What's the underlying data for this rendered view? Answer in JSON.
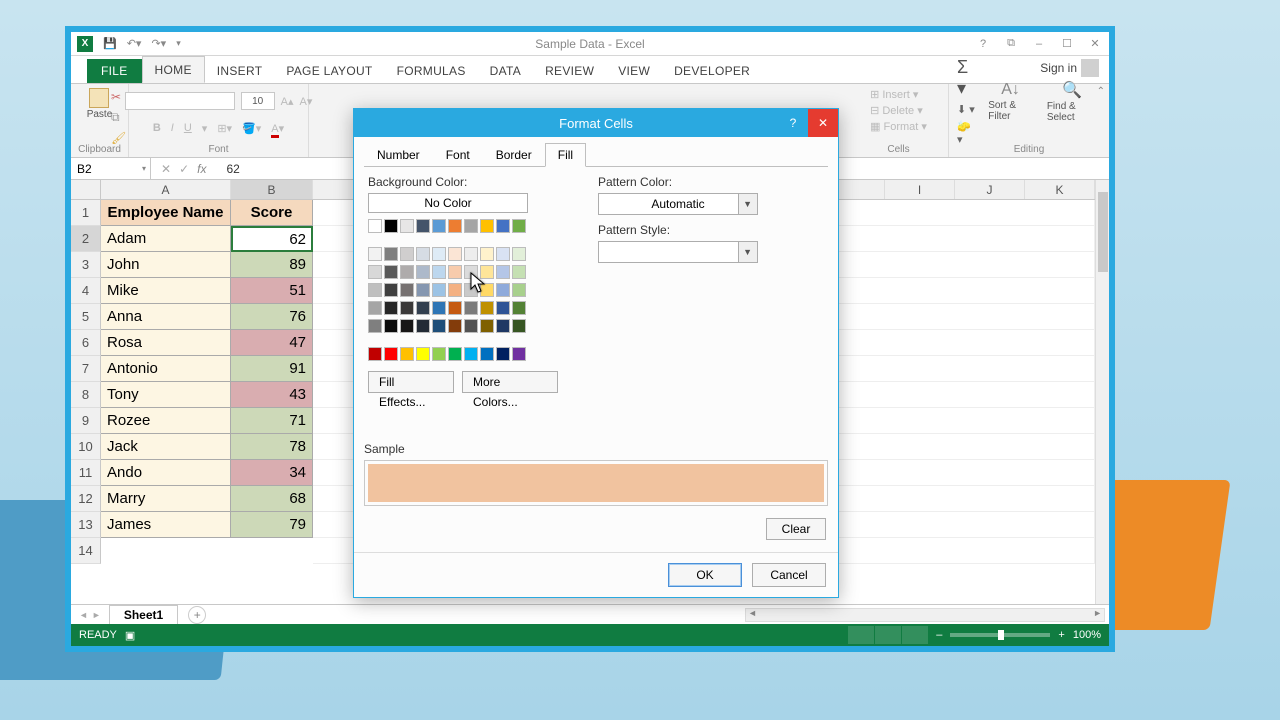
{
  "titlebar": {
    "title": "Sample Data - Excel"
  },
  "winbtns": {
    "help": "?",
    "rest": "⧉",
    "min": "–",
    "max": "☐",
    "close": "✕"
  },
  "ribbon_tabs": {
    "file": "FILE",
    "home": "HOME",
    "insert": "INSERT",
    "page_layout": "PAGE LAYOUT",
    "formulas": "FORMULAS",
    "data": "DATA",
    "review": "REVIEW",
    "view": "VIEW",
    "developer": "DEVELOPER",
    "signin": "Sign in"
  },
  "ribbon": {
    "paste": "Paste",
    "clipboard": "Clipboard",
    "font": "Font",
    "font_size": "10",
    "insert": "Insert",
    "delete": "Delete",
    "format": "Format",
    "cells": "Cells",
    "sort": "Sort & Filter",
    "find": "Find & Select",
    "editing": "Editing"
  },
  "formula_bar": {
    "name": "B2",
    "cancel": "✕",
    "enter": "✓",
    "fx": "fx",
    "value": "62"
  },
  "columns": {
    "a": "A",
    "b": "B",
    "i": "I",
    "j": "J",
    "k": "K"
  },
  "headers": {
    "name": "Employee Name",
    "score": "Score"
  },
  "rows": [
    {
      "n": 2,
      "name": "Adam",
      "score": 62,
      "cls": "sel"
    },
    {
      "n": 3,
      "name": "John",
      "score": 89,
      "cls": "score-green"
    },
    {
      "n": 4,
      "name": "Mike",
      "score": 51,
      "cls": "score-red"
    },
    {
      "n": 5,
      "name": "Anna",
      "score": 76,
      "cls": "score-green"
    },
    {
      "n": 6,
      "name": "Rosa",
      "score": 47,
      "cls": "score-red"
    },
    {
      "n": 7,
      "name": "Antonio",
      "score": 91,
      "cls": "score-green"
    },
    {
      "n": 8,
      "name": "Tony",
      "score": 43,
      "cls": "score-red"
    },
    {
      "n": 9,
      "name": "Rozee",
      "score": 71,
      "cls": "score-green"
    },
    {
      "n": 10,
      "name": "Jack",
      "score": 78,
      "cls": "score-green"
    },
    {
      "n": 11,
      "name": "Ando",
      "score": 34,
      "cls": "score-red"
    },
    {
      "n": 12,
      "name": "Marry",
      "score": 68,
      "cls": "score-green"
    },
    {
      "n": 13,
      "name": "James",
      "score": 79,
      "cls": "score-green"
    }
  ],
  "sheet_tabs": {
    "sheet1": "Sheet1"
  },
  "status": {
    "ready": "READY",
    "zoom": "100%"
  },
  "dialog": {
    "title": "Format Cells",
    "tabs": {
      "number": "Number",
      "font": "Font",
      "border": "Border",
      "fill": "Fill"
    },
    "bg_label": "Background Color:",
    "no_color": "No Color",
    "fill_effects": "Fill Effects...",
    "more_colors": "More Colors...",
    "pattern_color_label": "Pattern Color:",
    "pattern_color_value": "Automatic",
    "pattern_style_label": "Pattern Style:",
    "sample": "Sample",
    "clear": "Clear",
    "ok": "OK",
    "cancel": "Cancel",
    "help": "?",
    "close": "✕"
  },
  "palette": {
    "row_theme": [
      "#ffffff",
      "#000000",
      "#e7e6e6",
      "#44546a",
      "#5b9bd5",
      "#ed7d31",
      "#a5a5a5",
      "#ffc000",
      "#4472c4",
      "#70ad47"
    ],
    "tints": [
      [
        "#f2f2f2",
        "#7f7f7f",
        "#d0cece",
        "#d6dce4",
        "#deebf6",
        "#fbe5d5",
        "#ededed",
        "#fff2cc",
        "#d9e2f3",
        "#e2efd9"
      ],
      [
        "#d8d8d8",
        "#595959",
        "#aeabab",
        "#adb9ca",
        "#bdd7ee",
        "#f7cbac",
        "#dbdbdb",
        "#fee599",
        "#b4c6e7",
        "#c5e0b3"
      ],
      [
        "#bfbfbf",
        "#3f3f3f",
        "#757070",
        "#8496b0",
        "#9cc3e5",
        "#f4b183",
        "#c9c9c9",
        "#ffd965",
        "#8eaadb",
        "#a8d08d"
      ],
      [
        "#a5a5a5",
        "#262626",
        "#3a3838",
        "#323f4f",
        "#2e75b5",
        "#c55a11",
        "#7b7b7b",
        "#bf9000",
        "#2f5496",
        "#538135"
      ],
      [
        "#7f7f7f",
        "#0c0c0c",
        "#171616",
        "#222a35",
        "#1e4e79",
        "#833c0b",
        "#525252",
        "#7f6000",
        "#1f3864",
        "#375623"
      ]
    ],
    "standard": [
      "#c00000",
      "#ff0000",
      "#ffc000",
      "#ffff00",
      "#92d050",
      "#00b050",
      "#00b0f0",
      "#0070c0",
      "#002060",
      "#7030a0"
    ]
  }
}
